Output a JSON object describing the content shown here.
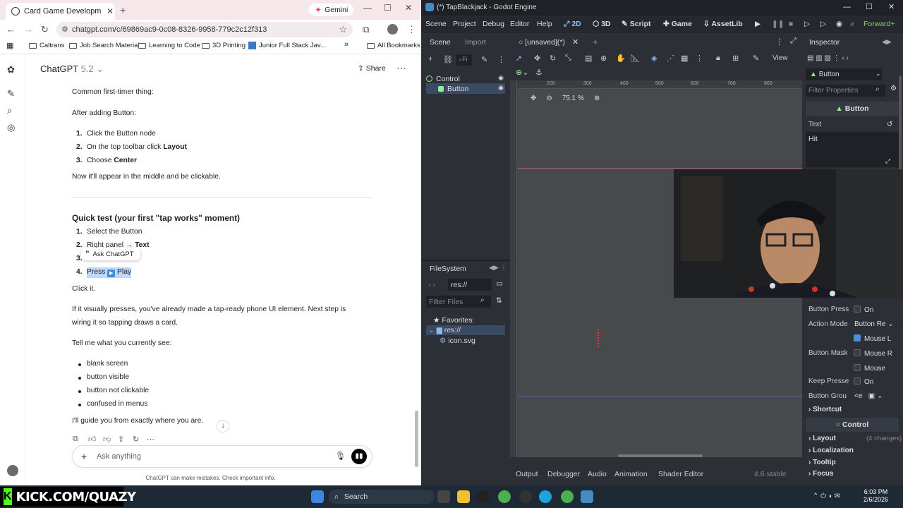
{
  "chrome": {
    "tab_title": "Card Game Development Guide",
    "gemini": "Gemini",
    "url": "chatgpt.com/c/69869ac9-0c08-8326-9958-779c2c12f313",
    "bookmarks": [
      "Caltrans",
      "Job Search Material",
      "Learning to Code",
      "3D Printing",
      "Junior Full Stack Jav...",
      "All Bookmarks"
    ],
    "more_bookmarks": "»"
  },
  "chatgpt": {
    "model": "ChatGPT",
    "version": "5.2",
    "share": "Share",
    "content": {
      "p1": "Common first-timer thing:",
      "p2": "After adding Button:",
      "steps1": [
        {
          "n": "1.",
          "text": "Click the Button node"
        },
        {
          "n": "2.",
          "pre": "On the top toolbar click ",
          "bold": "Layout"
        },
        {
          "n": "3.",
          "pre": "Choose ",
          "bold": "Center"
        }
      ],
      "p3": "Now it'll appear in the middle and be clickable.",
      "heading": "Quick test (your first \"tap works\" moment)",
      "steps2": [
        {
          "n": "1.",
          "text": "Select the Button"
        },
        {
          "n": "2.",
          "pre": "Right panel → ",
          "bold": "Text"
        },
        {
          "n": "3.",
          "text": ""
        },
        {
          "n": "4.",
          "pre": "Press ",
          "post": " Play"
        }
      ],
      "ask_popup": "Ask ChatGPT",
      "p4": "Click it.",
      "p5a": "If it visually presses, you've already made a tap-ready phone UI element. Next step is",
      "p5b": "wiring it so tapping draws a card.",
      "p6": "Tell me what you currently see:",
      "bullets": [
        "blank screen",
        "button visible",
        "button not clickable",
        "confused in menus"
      ],
      "p7": "I'll guide you from exactly where you are."
    },
    "input_placeholder": "Ask anything",
    "disclaimer": "ChatGPT can make mistakes. Check important info."
  },
  "godot": {
    "title": "(*) TapBlackjack - Godot Engine",
    "menu": [
      "Scene",
      "Project",
      "Debug",
      "Editor",
      "Help"
    ],
    "modes": [
      "2D",
      "3D",
      "Script",
      "Game",
      "AssetLib"
    ],
    "renderer": "Forward+",
    "scene_tabs": [
      "Scene",
      "Import"
    ],
    "tree": [
      {
        "name": "Control"
      },
      {
        "name": "Button"
      }
    ],
    "filter_short": "Fi",
    "editor_tab": "[unsaved](*)",
    "view": "View",
    "zoom": "75.1 %",
    "ruler": [
      "200",
      "300",
      "400",
      "500",
      "600",
      "700",
      "800"
    ],
    "filesystem": {
      "title": "FileSystem",
      "path": "res://",
      "filter": "Filter Files",
      "favorites": "Favorites:",
      "root": "res://",
      "file": "icon.svg"
    },
    "bottom_tabs": [
      "Output",
      "Debugger",
      "Audio",
      "Animation",
      "Shader Editor"
    ],
    "version": "4.6.stable",
    "inspector": {
      "title": "Inspector",
      "node": "Button",
      "filter": "Filter Properties",
      "section": "Button",
      "text_label": "Text",
      "text_value": "Hit",
      "rows": [
        {
          "label": "Button Press",
          "value": "On"
        },
        {
          "label": "Action Mode",
          "value": "Button Re"
        },
        {
          "label": "Button Mask",
          "values": [
            "Mouse L",
            "Mouse R",
            "Mouse"
          ]
        },
        {
          "label": "Keep Presse",
          "value": "On"
        },
        {
          "label": "Button Grou",
          "value": "<e"
        }
      ],
      "shortcut": "Shortcut",
      "control": "Control",
      "layout": "Layout",
      "layout_changes": "(4 changes)",
      "localization": "Localization",
      "tooltip": "Tooltip",
      "focus": "Focus"
    }
  },
  "taskbar": {
    "kick": "KICK.COM/QUAZY",
    "search": "Search",
    "time": "6:03 PM",
    "date": "2/6/2026"
  }
}
